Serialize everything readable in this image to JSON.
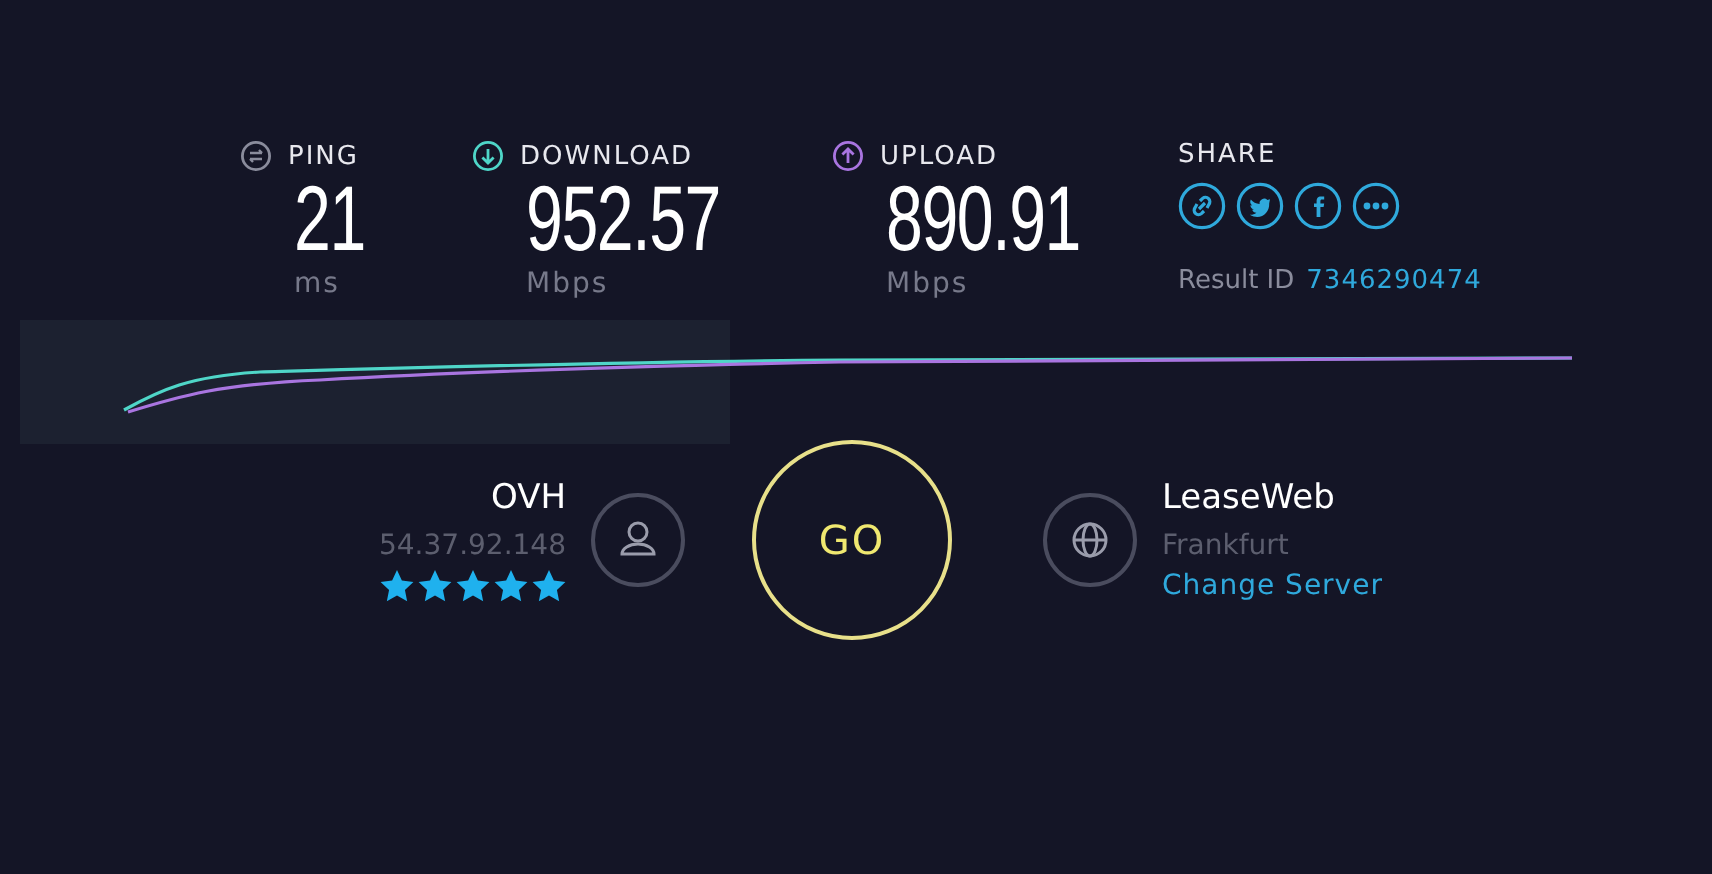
{
  "metrics": [
    {
      "kind": "ping",
      "label": "PING",
      "value": "21",
      "unit": "ms"
    },
    {
      "kind": "download",
      "label": "DOWNLOAD",
      "value": "952.57",
      "unit": "Mbps"
    },
    {
      "kind": "upload",
      "label": "UPLOAD",
      "value": "890.91",
      "unit": "Mbps"
    }
  ],
  "share": {
    "label": "SHARE",
    "result_label": "Result ID",
    "result_id": "7346290474"
  },
  "provider": {
    "name": "OVH",
    "ip": "54.37.92.148",
    "stars": 5
  },
  "go_button": "GO",
  "server": {
    "name": "LeaseWeb",
    "location": "Frankfurt",
    "change_link": "Change Server"
  }
}
